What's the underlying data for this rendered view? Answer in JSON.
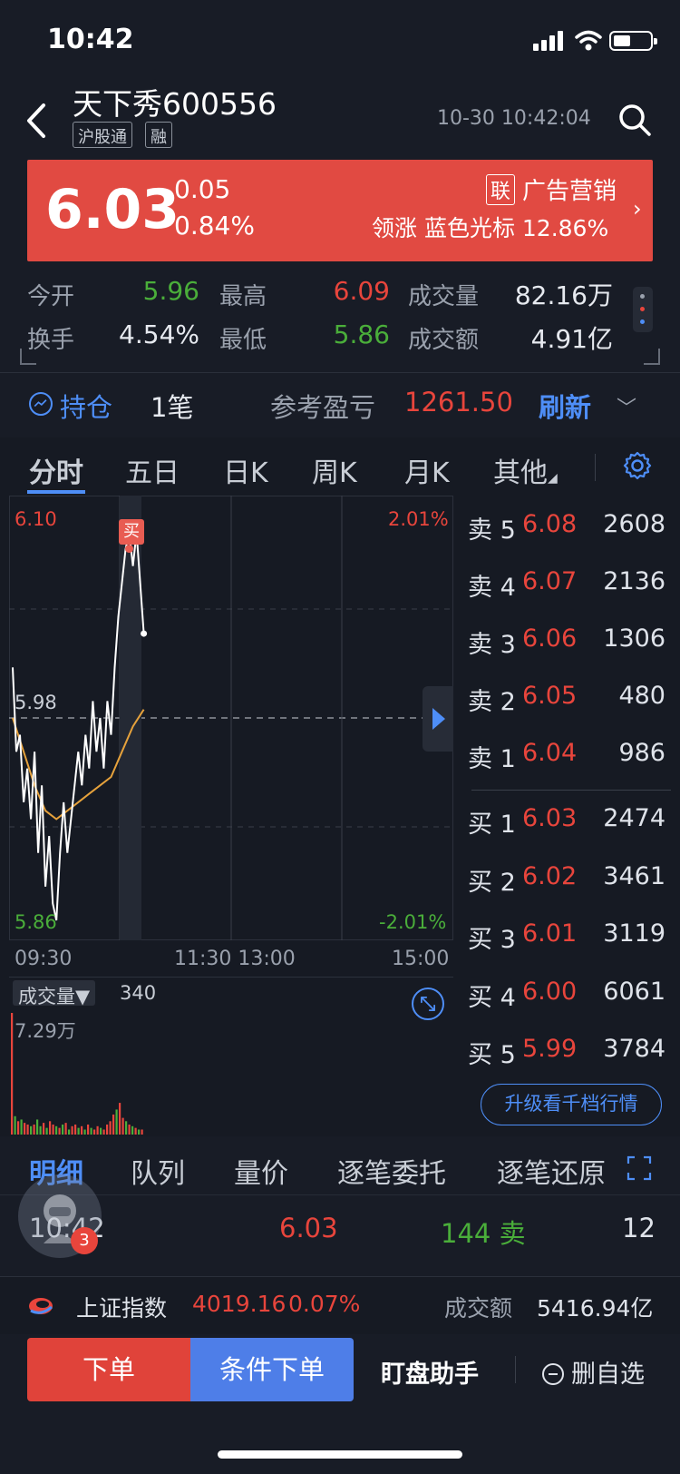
{
  "status_bar": {
    "time": "10:42"
  },
  "header": {
    "name": "天下秀",
    "code": "600556",
    "tags": [
      "沪股通",
      "融"
    ],
    "datetime": "10-30 10:42:04"
  },
  "banner": {
    "price": "6.03",
    "change": "0.05",
    "change_pct": "0.84%",
    "badge": "联",
    "sector": "广告营销",
    "leader_line": "领涨 蓝色光标 12.86%"
  },
  "stats": {
    "open_label": "今开",
    "open": "5.96",
    "high_label": "最高",
    "high": "6.09",
    "volume_label": "成交量",
    "volume": "82.16万",
    "turnover_label": "换手",
    "turnover": "4.54%",
    "low_label": "最低",
    "low": "5.86",
    "amount_label": "成交额",
    "amount": "4.91亿"
  },
  "position": {
    "label": "持仓",
    "count": "1笔",
    "pl_label": "参考盈亏",
    "pl_value": "1261.50",
    "refresh": "刷新"
  },
  "chart_tabs": [
    "分时",
    "五日",
    "日K",
    "周K",
    "月K",
    "其他"
  ],
  "chart_labels": {
    "y_max": "6.10",
    "y_mid": "5.98",
    "y_min": "5.86",
    "pct_max": "2.01%",
    "pct_min": "-2.01%",
    "x_ticks": [
      "09:30",
      "11:30 13:00",
      "15:00"
    ],
    "buy_marker": "买"
  },
  "volume_panel": {
    "selector": "成交量▼",
    "current": "340",
    "max_label": "7.29万"
  },
  "order_book": {
    "asks": [
      {
        "label": "卖5",
        "price": "6.08",
        "vol": "2608"
      },
      {
        "label": "卖4",
        "price": "6.07",
        "vol": "2136"
      },
      {
        "label": "卖3",
        "price": "6.06",
        "vol": "1306"
      },
      {
        "label": "卖2",
        "price": "6.05",
        "vol": "480"
      },
      {
        "label": "卖1",
        "price": "6.04",
        "vol": "986"
      }
    ],
    "bids": [
      {
        "label": "买1",
        "price": "6.03",
        "vol": "2474"
      },
      {
        "label": "买2",
        "price": "6.02",
        "vol": "3461"
      },
      {
        "label": "买3",
        "price": "6.01",
        "vol": "3119"
      },
      {
        "label": "买4",
        "price": "6.00",
        "vol": "6061"
      },
      {
        "label": "买5",
        "price": "5.99",
        "vol": "3784"
      }
    ],
    "upgrade": "升级看千档行情"
  },
  "detail_tabs": [
    "明细",
    "队列",
    "量价",
    "逐笔委托",
    "逐笔还原"
  ],
  "tick": {
    "time": "10:42",
    "price": "6.03",
    "vol": "144 卖",
    "count": "12",
    "badge": "3"
  },
  "index_bar": {
    "name": "上证指数",
    "value": "4019.16",
    "change": "0.07%",
    "amount_label": "成交额",
    "amount": "5416.94亿"
  },
  "actions": {
    "order": "下单",
    "cond_order": "条件下单",
    "watch": "盯盘助手",
    "remove": "删自选"
  },
  "chart_data": {
    "type": "line",
    "title": "",
    "ylim": [
      5.86,
      6.1
    ],
    "reference_price": 5.98,
    "series": [
      {
        "x_minutes": [
          0,
          2,
          4,
          6,
          8,
          10,
          12,
          14,
          16,
          18,
          20,
          22,
          24,
          26,
          28,
          30,
          32,
          34,
          36,
          38,
          40,
          42,
          44,
          46,
          48,
          50,
          52,
          54,
          56,
          58,
          60,
          62,
          64,
          66,
          68,
          70,
          72
        ],
        "values": [
          6.01,
          5.96,
          5.97,
          5.93,
          5.95,
          5.92,
          5.96,
          5.9,
          5.94,
          5.88,
          5.91,
          5.87,
          5.86,
          5.9,
          5.93,
          5.9,
          5.92,
          5.94,
          5.96,
          5.94,
          5.97,
          5.95,
          5.99,
          5.96,
          5.98,
          5.95,
          5.99,
          5.97,
          6.01,
          6.04,
          6.06,
          6.08,
          6.09,
          6.07,
          6.09,
          6.06,
          6.03
        ]
      },
      {
        "x_minutes": [
          0,
          6,
          12,
          18,
          24,
          30,
          36,
          42,
          48,
          54,
          60,
          66,
          72
        ],
        "values": [
          5.98,
          5.96,
          5.94,
          5.925,
          5.92,
          5.925,
          5.93,
          5.935,
          5.94,
          5.945,
          5.96,
          5.975,
          5.985
        ]
      }
    ],
    "volume_wan": [
      7.29,
      1.1,
      0.8,
      0.9,
      0.7,
      0.6,
      0.5,
      0.6,
      0.9,
      0.5,
      0.7,
      0.4,
      0.8,
      0.6,
      0.5,
      0.4,
      0.6,
      0.7,
      0.3,
      0.5,
      0.6,
      0.4,
      0.5,
      0.3,
      0.6,
      0.4,
      0.3,
      0.5,
      0.4,
      0.3,
      0.6,
      0.8,
      1.2,
      1.5,
      1.9,
      1.0,
      0.8,
      0.6,
      0.5,
      0.4,
      0.3,
      0.3
    ],
    "volume_up": [
      1,
      0,
      1,
      0,
      1,
      1,
      0,
      1,
      0,
      0,
      1,
      0,
      1,
      1,
      0,
      1,
      0,
      1,
      0,
      1,
      1,
      0,
      1,
      0,
      1,
      0,
      1,
      1,
      0,
      1,
      1,
      1,
      1,
      0,
      1,
      1,
      0,
      1,
      0,
      1,
      0,
      1
    ]
  }
}
